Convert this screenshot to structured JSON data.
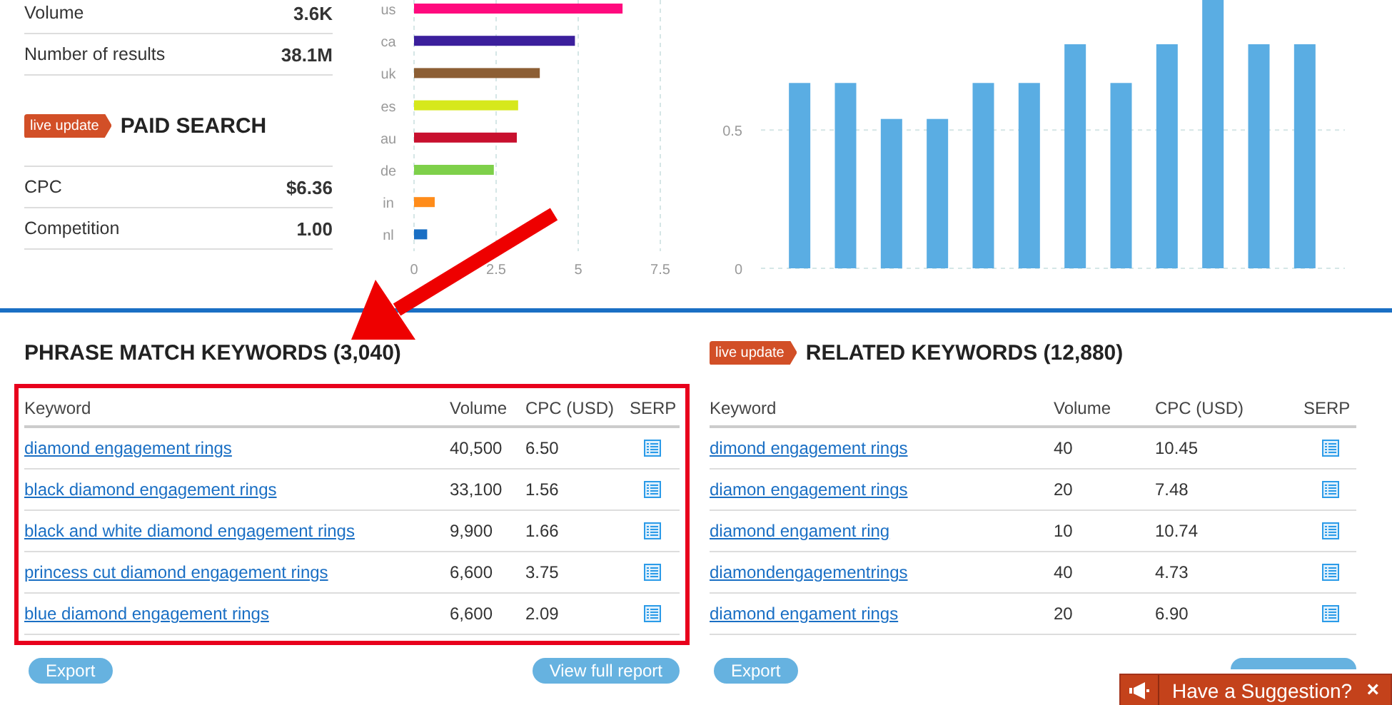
{
  "summary": {
    "rows": [
      {
        "label": "Volume",
        "value": "3.6K"
      },
      {
        "label": "Number of results",
        "value": "38.1M"
      }
    ]
  },
  "paid_search": {
    "badge": "live update",
    "title": "PAID SEARCH",
    "rows": [
      {
        "label": "CPC",
        "value": "$6.36"
      },
      {
        "label": "Competition",
        "value": "1.00"
      }
    ]
  },
  "country_chart": {
    "chart_data": {
      "type": "bar",
      "orientation": "horizontal",
      "stacked": true,
      "categories": [
        "us",
        "ca",
        "uk",
        "es",
        "au",
        "de",
        "in",
        "nl"
      ],
      "xlim": [
        0,
        7.5
      ],
      "xticks": [
        0,
        2.5,
        5,
        7.5
      ],
      "series": [
        {
          "color": "#ff0a7e",
          "values": [
            6.35,
            null,
            null,
            null,
            null,
            null,
            null,
            null
          ]
        },
        {
          "color": "#3b1f9c",
          "values": [
            null,
            4.9,
            null,
            null,
            null,
            null,
            null,
            null
          ]
        },
        {
          "color": "#8c5e34",
          "values": [
            null,
            null,
            3.83,
            null,
            null,
            null,
            null,
            null
          ]
        },
        {
          "color": "#d6e81c",
          "values": [
            null,
            null,
            null,
            3.17,
            null,
            null,
            null,
            null
          ]
        },
        {
          "color": "#c8102e",
          "values": [
            null,
            null,
            null,
            null,
            3.13,
            null,
            null,
            null
          ]
        },
        {
          "color": "#7ed04a",
          "values": [
            null,
            null,
            null,
            null,
            null,
            2.43,
            null,
            null
          ]
        },
        {
          "color": "#ff8c1a",
          "values": [
            null,
            null,
            null,
            null,
            null,
            null,
            0.63,
            null
          ]
        },
        {
          "color": "#1a6fc4",
          "values": [
            null,
            null,
            null,
            null,
            null,
            null,
            null,
            0.4
          ]
        }
      ]
    }
  },
  "trend_chart": {
    "chart_data": {
      "type": "bar",
      "ylim": [
        0,
        0.97
      ],
      "yticks": [
        0,
        0.5
      ],
      "series": [
        {
          "color": "#5aade3",
          "values": [
            0.67,
            0.67,
            0.54,
            0.54,
            0.67,
            0.67,
            0.81,
            0.67,
            0.81,
            0.97,
            0.81,
            0.81
          ]
        }
      ]
    }
  },
  "phrase_match": {
    "title": "PHRASE MATCH KEYWORDS (3,040)",
    "highlighted": true,
    "columns": [
      "Keyword",
      "Volume",
      "CPC (USD)",
      "SERP"
    ],
    "rows": [
      {
        "keyword": "diamond engagement rings",
        "volume": "40,500",
        "cpc": "6.50"
      },
      {
        "keyword": "black diamond engagement rings",
        "volume": "33,100",
        "cpc": "1.56"
      },
      {
        "keyword": "black and white diamond engagement rings",
        "volume": "9,900",
        "cpc": "1.66"
      },
      {
        "keyword": "princess cut diamond engagement rings",
        "volume": "6,600",
        "cpc": "3.75"
      },
      {
        "keyword": "blue diamond engagement rings",
        "volume": "6,600",
        "cpc": "2.09"
      }
    ],
    "buttons": [
      {
        "kind": "button",
        "label": "Export"
      },
      {
        "kind": "button",
        "label": "View full report"
      }
    ]
  },
  "related": {
    "badge": "live update",
    "title": "RELATED KEYWORDS (12,880)",
    "highlighted": false,
    "columns": [
      "Keyword",
      "Volume",
      "CPC (USD)",
      "SERP"
    ],
    "rows": [
      {
        "keyword": "dimond engagement rings",
        "volume": "40",
        "cpc": "10.45"
      },
      {
        "keyword": "diamon engagement rings",
        "volume": "20",
        "cpc": "7.48"
      },
      {
        "keyword": "diamond engament ring",
        "volume": "10",
        "cpc": "10.74"
      },
      {
        "keyword": "diamondengagementrings",
        "volume": "40",
        "cpc": "4.73"
      },
      {
        "keyword": "diamond engament rings",
        "volume": "20",
        "cpc": "6.90"
      }
    ],
    "buttons": [
      {
        "kind": "button",
        "label": "Export"
      },
      {
        "kind": "covered"
      }
    ]
  },
  "annotations": [
    {
      "kind": "arrow"
    }
  ],
  "suggestion_bar": {
    "label": "Have a Suggestion?",
    "close": "×"
  }
}
